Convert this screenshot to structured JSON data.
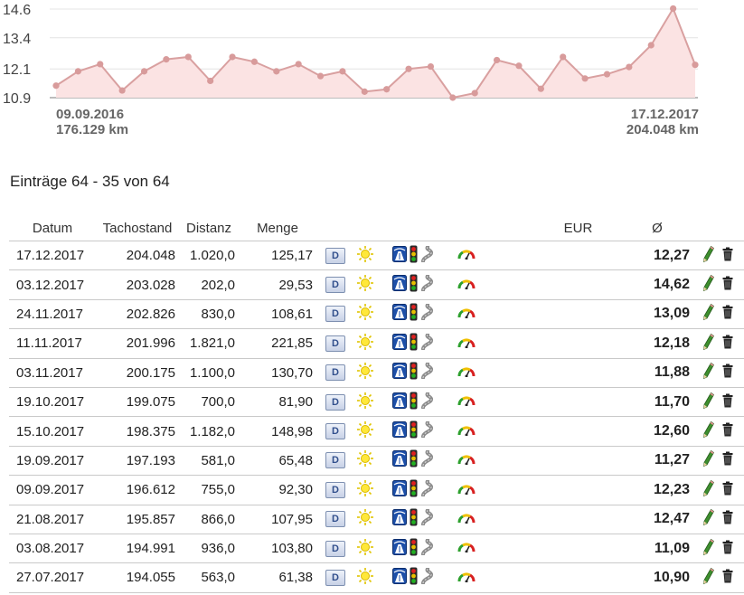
{
  "chart_data": {
    "type": "area",
    "yticks": [
      "14.6",
      "13.4",
      "12.1",
      "10.9"
    ],
    "ylim": [
      10.9,
      14.6
    ],
    "start_label": {
      "date": "09.09.2016",
      "km": "176.129 km"
    },
    "end_label": {
      "date": "17.12.2017",
      "km": "204.048 km"
    },
    "values": [
      11.4,
      12.0,
      12.3,
      11.2,
      12.0,
      12.5,
      12.6,
      11.6,
      12.6,
      12.4,
      12.0,
      12.3,
      11.8,
      12.0,
      11.15,
      11.25,
      12.1,
      12.2,
      10.9,
      11.09,
      12.47,
      12.23,
      11.27,
      12.6,
      11.7,
      11.88,
      12.18,
      13.09,
      14.62,
      12.27
    ],
    "colors": {
      "line": "#d9a0a0",
      "fill": "#fbe3e3",
      "point": "#d89b9b"
    }
  },
  "summary": "Einträge 64 - 35 von 64",
  "columns": {
    "date": "Datum",
    "odometer": "Tachostand",
    "distance": "Distanz",
    "amount": "Menge",
    "eur": "EUR",
    "avg": "Ø"
  },
  "rows": [
    {
      "date": "17.12.2017",
      "odometer": "204.048",
      "distance": "1.020,0",
      "amount": "125,17",
      "fuel": "D",
      "avg": "12,27"
    },
    {
      "date": "03.12.2017",
      "odometer": "203.028",
      "distance": "202,0",
      "amount": "29,53",
      "fuel": "D",
      "avg": "14,62"
    },
    {
      "date": "24.11.2017",
      "odometer": "202.826",
      "distance": "830,0",
      "amount": "108,61",
      "fuel": "D",
      "avg": "13,09"
    },
    {
      "date": "11.11.2017",
      "odometer": "201.996",
      "distance": "1.821,0",
      "amount": "221,85",
      "fuel": "D",
      "avg": "12,18"
    },
    {
      "date": "03.11.2017",
      "odometer": "200.175",
      "distance": "1.100,0",
      "amount": "130,70",
      "fuel": "D",
      "avg": "11,88"
    },
    {
      "date": "19.10.2017",
      "odometer": "199.075",
      "distance": "700,0",
      "amount": "81,90",
      "fuel": "D",
      "avg": "11,70"
    },
    {
      "date": "15.10.2017",
      "odometer": "198.375",
      "distance": "1.182,0",
      "amount": "148,98",
      "fuel": "D",
      "avg": "12,60"
    },
    {
      "date": "19.09.2017",
      "odometer": "197.193",
      "distance": "581,0",
      "amount": "65,48",
      "fuel": "D",
      "avg": "11,27"
    },
    {
      "date": "09.09.2017",
      "odometer": "196.612",
      "distance": "755,0",
      "amount": "92,30",
      "fuel": "D",
      "avg": "12,23"
    },
    {
      "date": "21.08.2017",
      "odometer": "195.857",
      "distance": "866,0",
      "amount": "107,95",
      "fuel": "D",
      "avg": "12,47"
    },
    {
      "date": "03.08.2017",
      "odometer": "194.991",
      "distance": "936,0",
      "amount": "103,80",
      "fuel": "D",
      "avg": "11,09"
    },
    {
      "date": "27.07.2017",
      "odometer": "194.055",
      "distance": "563,0",
      "amount": "61,38",
      "fuel": "D",
      "avg": "10,90"
    }
  ],
  "icons": {
    "weather": "sun-icon",
    "roads": [
      "motorway-icon",
      "traffic-light-icon",
      "country-road-icon"
    ],
    "style": "speedometer-icon",
    "edit": "pencil-icon",
    "delete": "trash-icon"
  }
}
